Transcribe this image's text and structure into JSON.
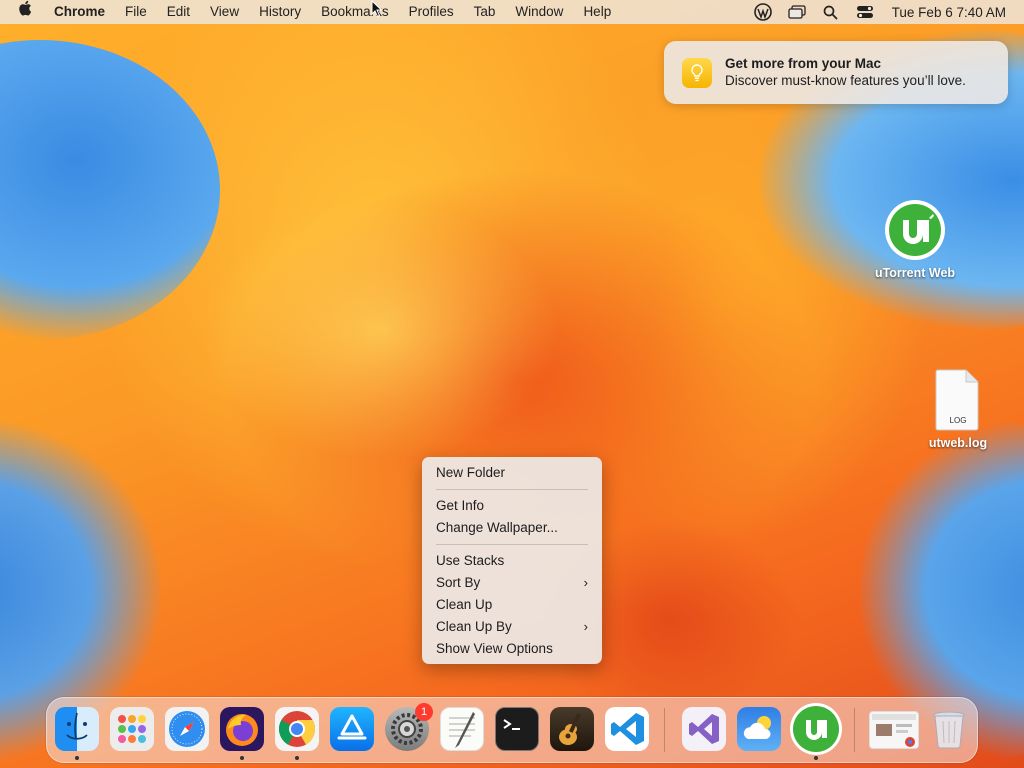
{
  "menubar": {
    "app_name": "Chrome",
    "items": [
      "File",
      "Edit",
      "View",
      "History",
      "Bookmarks",
      "Profiles",
      "Tab",
      "Window",
      "Help"
    ],
    "clock": "Tue Feb 6  7:40 AM"
  },
  "notification": {
    "title": "Get more from your Mac",
    "body": "Discover must-know features you’ll love."
  },
  "desktop": {
    "icons": [
      {
        "label": "uTorrent Web"
      },
      {
        "label": "utweb.log",
        "file_badge": "LOG"
      }
    ]
  },
  "context_menu": {
    "items": [
      "New Folder",
      "Get Info",
      "Change Wallpaper...",
      "Use Stacks",
      "Sort By",
      "Clean Up",
      "Clean Up By",
      "Show View Options"
    ]
  },
  "dock": {
    "settings_badge": "1",
    "apps": [
      "finder-icon",
      "launchpad-icon",
      "safari-icon",
      "firefox-icon",
      "chrome-icon",
      "app-store-icon",
      "system-settings-icon",
      "textedit-icon",
      "terminal-icon",
      "garageband-icon",
      "vscode-icon",
      "visual-studio-icon",
      "weather-icon",
      "utorrent-icon",
      "chrome-window-icon",
      "trash-icon"
    ]
  },
  "colors": {
    "utorrent_green": "#3eb13b",
    "notification_icon": "#f5b400",
    "badge_red": "#ff3b30"
  }
}
